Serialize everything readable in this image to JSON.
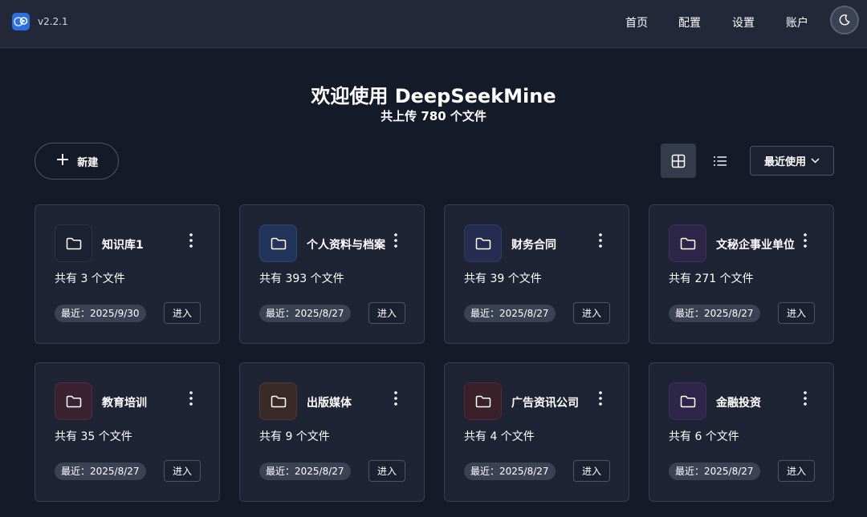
{
  "header": {
    "version": "v2.2.1",
    "nav": [
      "首页",
      "配置",
      "设置",
      "账户"
    ],
    "logo_icon": "brain-logo-icon",
    "theme_icon": "moon-icon"
  },
  "hero": {
    "title": "欢迎使用 DeepSeekMine",
    "subtitle": "共上传 780 个文件"
  },
  "toolbar": {
    "new_label": "新建",
    "sort_label": "最近使用",
    "view_modes": [
      "grid-view-icon",
      "list-view-icon"
    ],
    "active_view": "grid"
  },
  "colors": {
    "background": "#141a28",
    "header": "#222837",
    "card": "#1e2433",
    "brand": "#2b6fe0"
  },
  "cards": [
    {
      "name": "知识库1",
      "count": "共有 3 个文件",
      "date": "最近：2025/9/30",
      "enter": "进入",
      "icon_bg": "#1a2130",
      "icon_border": "#2c3445"
    },
    {
      "name": "个人资料与档案",
      "count": "共有 393 个文件",
      "date": "最近：2025/8/27",
      "enter": "进入",
      "icon_bg": "#22345a",
      "icon_border": "#2f4575"
    },
    {
      "name": "财务合同",
      "count": "共有 39 个文件",
      "date": "最近：2025/8/27",
      "enter": "进入",
      "icon_bg": "#262c4f",
      "icon_border": "#333b63"
    },
    {
      "name": "文秘企事业单位",
      "count": "共有 271 个文件",
      "date": "最近：2025/8/27",
      "enter": "进入",
      "icon_bg": "#2e2648",
      "icon_border": "#3c3160"
    },
    {
      "name": "教育培训",
      "count": "共有 35 个文件",
      "date": "最近：2025/8/27",
      "enter": "进入",
      "icon_bg": "#3a2230",
      "icon_border": "#552c3f"
    },
    {
      "name": "出版媒体",
      "count": "共有 9 个文件",
      "date": "最近：2025/8/27",
      "enter": "进入",
      "icon_bg": "#3a2a27",
      "icon_border": "#55392f"
    },
    {
      "name": "广告资讯公司",
      "count": "共有 4 个文件",
      "date": "最近：2025/8/27",
      "enter": "进入",
      "icon_bg": "#3a2029",
      "icon_border": "#55293a"
    },
    {
      "name": "金融投资",
      "count": "共有 6 个文件",
      "date": "最近：2025/8/27",
      "enter": "进入",
      "icon_bg": "#2e2648",
      "icon_border": "#3c3160"
    }
  ]
}
